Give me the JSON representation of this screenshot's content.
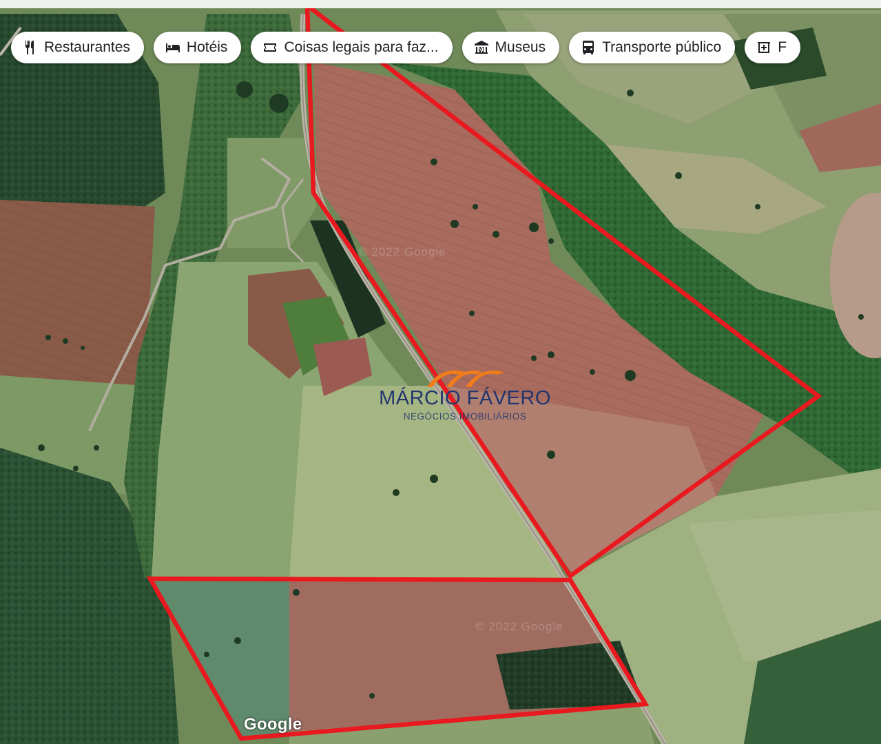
{
  "map": {
    "type": "satellite",
    "attribution": "Google"
  },
  "categories": [
    {
      "label": "Restaurantes",
      "icon": "restaurant-icon"
    },
    {
      "label": "Hotéis",
      "icon": "hotel-bed-icon"
    },
    {
      "label": "Coisas legais para faz...",
      "icon": "ticket-icon"
    },
    {
      "label": "Museus",
      "icon": "museum-icon"
    },
    {
      "label": "Transporte público",
      "icon": "bus-icon"
    },
    {
      "label": "F",
      "icon": "pharmacy-icon"
    }
  ],
  "watermark": {
    "name": "MÁRCIO FÁVERO",
    "subtitle": "NEGÓCIOS IMOBILIÁRIOS",
    "logo_color": "#f07c1c",
    "text_color": "#22356e"
  },
  "faint_labels": [
    "© 2022 Google",
    "© 2022 Google"
  ],
  "boundary_color": "#e8191f"
}
